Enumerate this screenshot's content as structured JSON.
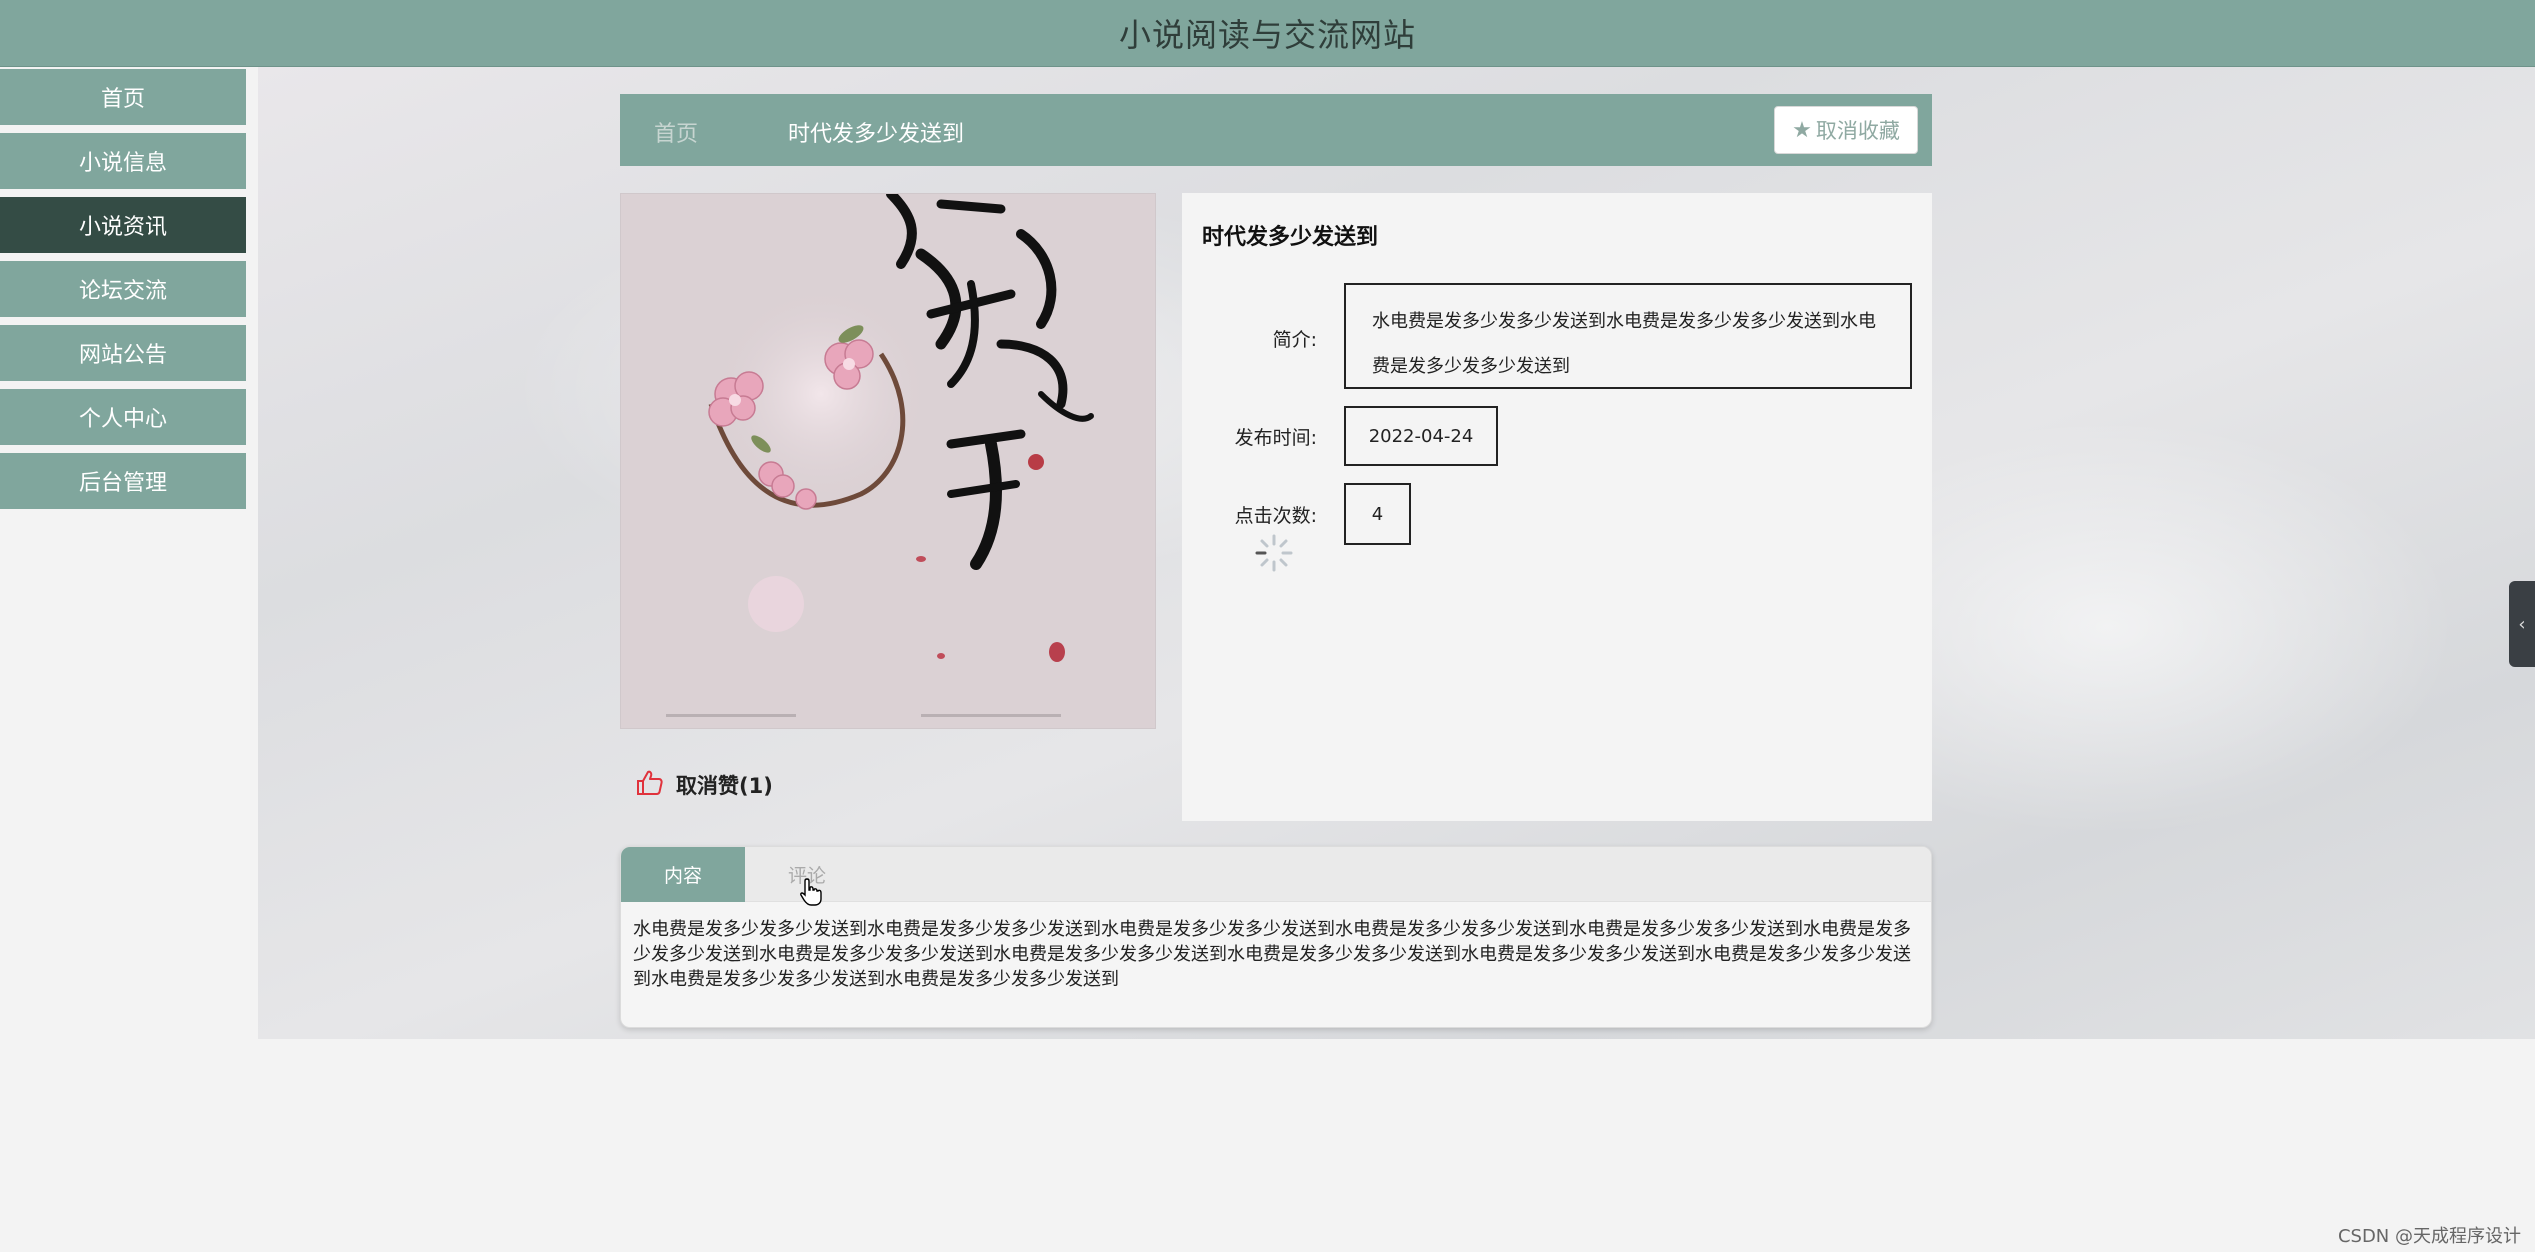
{
  "header": {
    "title": "小说阅读与交流网站"
  },
  "sidebar": {
    "items": [
      {
        "label": "首页",
        "active": false
      },
      {
        "label": "小说信息",
        "active": false
      },
      {
        "label": "小说资讯",
        "active": true
      },
      {
        "label": "论坛交流",
        "active": false
      },
      {
        "label": "网站公告",
        "active": false
      },
      {
        "label": "个人中心",
        "active": false
      },
      {
        "label": "后台管理",
        "active": false
      }
    ]
  },
  "breadcrumb": {
    "home": "首页",
    "current": "时代发多少发送到",
    "favorite_button": "取消收藏"
  },
  "like": {
    "label": "取消赞(1)"
  },
  "detail": {
    "title": "时代发多少发送到",
    "intro_label": "简介:",
    "intro_value": "水电费是发多少发多少发送到水电费是发多少发多少发送到水电费是发多少发多少发送到",
    "publish_label": "发布时间:",
    "publish_value": "2022-04-24",
    "clicks_label": "点击次数:",
    "clicks_value": "4"
  },
  "tabs": {
    "content_tab": "内容",
    "comment_tab": "评论",
    "content_text": "水电费是发多少发多少发送到水电费是发多少发多少发送到水电费是发多少发多少发送到水电费是发多少发多少发送到水电费是发多少发多少发送到水电费是发多少发多少发送到水电费是发多少发多少发送到水电费是发多少发多少发送到水电费是发多少发多少发送到水电费是发多少发多少发送到水电费是发多少发多少发送到水电费是发多少发多少发送到水电费是发多少发多少发送到"
  },
  "watermark": "CSDN @天成程序设计",
  "colors": {
    "accent": "#80a69d",
    "active_nav": "#344c45"
  }
}
